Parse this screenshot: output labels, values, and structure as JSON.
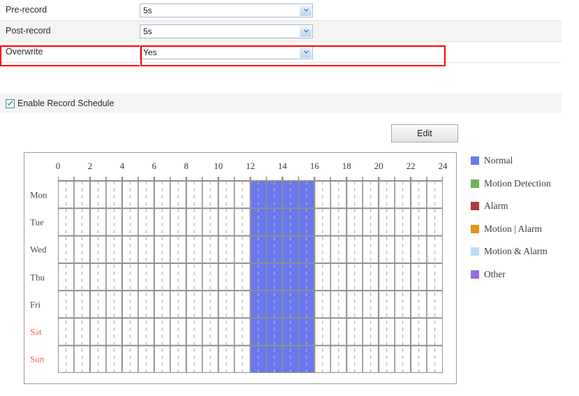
{
  "settings_rows": [
    {
      "label": "Pre-record",
      "value": "5s",
      "highlighted": false
    },
    {
      "label": "Post-record",
      "value": "5s",
      "highlighted": false
    },
    {
      "label": "Overwrite",
      "value": "Yes",
      "highlighted": true
    }
  ],
  "enable_record_schedule": {
    "label": "Enable Record Schedule",
    "checked": true
  },
  "edit_button": {
    "label": "Edit"
  },
  "schedule": {
    "hour_labels": [
      "0",
      "2",
      "4",
      "6",
      "8",
      "10",
      "12",
      "14",
      "16",
      "18",
      "20",
      "22",
      "24"
    ],
    "hour_values": [
      0,
      2,
      4,
      6,
      8,
      10,
      12,
      14,
      16,
      18,
      20,
      22,
      24
    ],
    "axis_min": 0,
    "axis_max": 24,
    "days": [
      {
        "label": "Mon",
        "weekend": false,
        "blocks": [
          {
            "start": 12,
            "end": 16,
            "type": "Normal"
          }
        ]
      },
      {
        "label": "Tue",
        "weekend": false,
        "blocks": [
          {
            "start": 12,
            "end": 16,
            "type": "Normal"
          }
        ]
      },
      {
        "label": "Wed",
        "weekend": false,
        "blocks": [
          {
            "start": 12,
            "end": 16,
            "type": "Normal"
          }
        ]
      },
      {
        "label": "Thu",
        "weekend": false,
        "blocks": [
          {
            "start": 12,
            "end": 16,
            "type": "Normal"
          }
        ]
      },
      {
        "label": "Fri",
        "weekend": false,
        "blocks": [
          {
            "start": 12,
            "end": 16,
            "type": "Normal"
          }
        ]
      },
      {
        "label": "Sat",
        "weekend": true,
        "blocks": [
          {
            "start": 12,
            "end": 16,
            "type": "Normal"
          }
        ]
      },
      {
        "label": "Sun",
        "weekend": true,
        "blocks": [
          {
            "start": 12,
            "end": 16,
            "type": "Normal"
          }
        ]
      }
    ]
  },
  "legend": [
    {
      "label": "Normal",
      "color": "#6a78ef"
    },
    {
      "label": "Motion Detection",
      "color": "#6fb254"
    },
    {
      "label": "Alarm",
      "color": "#b0393f"
    },
    {
      "label": "Motion | Alarm",
      "color": "#e8920d"
    },
    {
      "label": "Motion & Alarm",
      "color": "#b9dcf5"
    },
    {
      "label": "Other",
      "color": "#9a6ade"
    }
  ],
  "colors": {
    "highlight_border": "#ff0000",
    "grid_line": "#8f8f8f",
    "grid_dash": "#b4b4b4",
    "block_fill": "#6a78ef",
    "checkbox_check": "#3aa12a",
    "weekend_text": "#ff5b5b"
  },
  "icons": {
    "dropdown": "chevron-down-icon",
    "checkbox": "checkmark-icon"
  }
}
